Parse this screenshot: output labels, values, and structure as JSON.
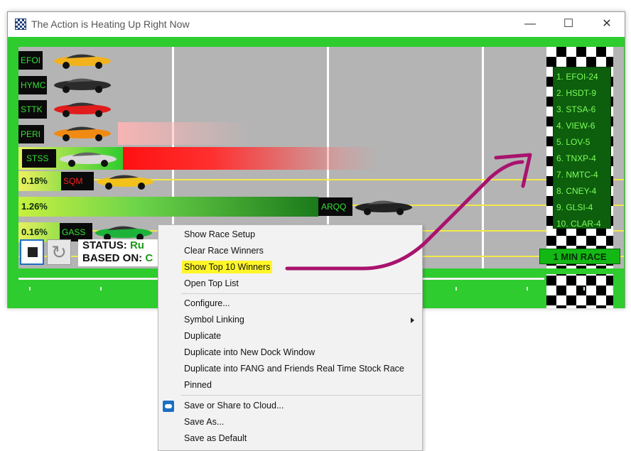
{
  "window": {
    "title": "The Action is Heating Up Right Now",
    "controls": {
      "minimize": "—",
      "maximize": "☐",
      "close": "✕"
    }
  },
  "race": {
    "lanes": [
      {
        "symbol": "EFOI",
        "car_color": "#f2b21b"
      },
      {
        "symbol": "HYMC",
        "car_color": "#2b2b2b"
      },
      {
        "symbol": "STTK",
        "car_color": "#e01c1c"
      },
      {
        "symbol": "PERI",
        "car_color": "#f08a12"
      },
      {
        "symbol": "STSS",
        "car_color": "#d8d8d8"
      },
      {
        "symbol": "SQM",
        "percent": "0.18%",
        "car_color": "#f2c21b"
      },
      {
        "symbol": "ARQQ",
        "percent": "1.26%",
        "car_color": "#222222"
      },
      {
        "symbol": "GASS",
        "percent": "0.16%",
        "car_color": "#1db33a"
      }
    ],
    "status_label": "STATUS:",
    "status_value": "Ru",
    "based_on_label": "BASED ON:",
    "based_on_value": "C",
    "top_winners": [
      "1. EFOI-24",
      "2. HSDT-9",
      "3. STSA-6",
      "4. VIEW-6",
      "5. LOV-5",
      "6. TNXP-4",
      "7. NMTC-4",
      "8. CNEY-4",
      "9. GLSI-4",
      "10. CLAR-4"
    ],
    "race_length_badge": "1 MIN RACE",
    "colors": {
      "grass": "#2ecc2e",
      "track": "#b4b4b4",
      "lane_line": "#f3e84a",
      "label_text": "#34e034",
      "winner_text": "#7cff5b"
    }
  },
  "context_menu": {
    "items": [
      {
        "label": "Show Race Setup"
      },
      {
        "label": "Clear Race Winners"
      },
      {
        "label": "Show Top 10 Winners",
        "highlighted": true
      },
      {
        "label": "Open Top List"
      },
      {
        "label": "Configure..."
      },
      {
        "label": "Symbol Linking",
        "submenu": true
      },
      {
        "label": "Duplicate"
      },
      {
        "label": "Duplicate into New Dock Window"
      },
      {
        "label": "Duplicate into FANG and Friends Real Time Stock Race"
      },
      {
        "label": "Pinned"
      },
      {
        "label": "Save or Share to Cloud...",
        "icon": "cloud-share-icon"
      },
      {
        "label": "Save As..."
      },
      {
        "label": "Save as Default"
      }
    ]
  },
  "annotation": {
    "arrow_color": "#a8136d"
  }
}
